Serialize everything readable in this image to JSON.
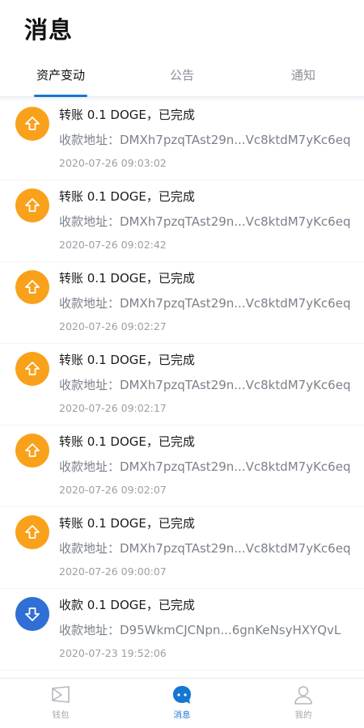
{
  "header": {
    "title": "消息"
  },
  "tabs": [
    {
      "label": "资产变动",
      "active": true
    },
    {
      "label": "公告",
      "active": false
    },
    {
      "label": "通知",
      "active": false
    }
  ],
  "colors": {
    "accent": "#1677d2",
    "outgoing": "#f9a11b",
    "incoming": "#2f6fd6"
  },
  "messages": [
    {
      "direction": "out",
      "icon": "arrow-up-icon",
      "title": "转账 0.1 DOGE，已完成",
      "address": "收款地址：DMXh7pzqTAst29n...Vc8ktdM7yKc6eq",
      "time": "2020-07-26 09:03:02"
    },
    {
      "direction": "out",
      "icon": "arrow-up-icon",
      "title": "转账 0.1 DOGE，已完成",
      "address": "收款地址：DMXh7pzqTAst29n...Vc8ktdM7yKc6eq",
      "time": "2020-07-26 09:02:42"
    },
    {
      "direction": "out",
      "icon": "arrow-up-icon",
      "title": "转账 0.1 DOGE，已完成",
      "address": "收款地址：DMXh7pzqTAst29n...Vc8ktdM7yKc6eq",
      "time": "2020-07-26 09:02:27"
    },
    {
      "direction": "out",
      "icon": "arrow-up-icon",
      "title": "转账 0.1 DOGE，已完成",
      "address": "收款地址：DMXh7pzqTAst29n...Vc8ktdM7yKc6eq",
      "time": "2020-07-26 09:02:17"
    },
    {
      "direction": "out",
      "icon": "arrow-up-icon",
      "title": "转账 0.1 DOGE，已完成",
      "address": "收款地址：DMXh7pzqTAst29n...Vc8ktdM7yKc6eq",
      "time": "2020-07-26 09:02:07"
    },
    {
      "direction": "out",
      "icon": "arrow-up-icon",
      "title": "转账 0.1 DOGE，已完成",
      "address": "收款地址：DMXh7pzqTAst29n...Vc8ktdM7yKc6eq",
      "time": "2020-07-26 09:00:07"
    },
    {
      "direction": "in",
      "icon": "arrow-down-icon",
      "title": "收款 0.1 DOGE，已完成",
      "address": "收款地址：D95WkmCJCNpn...6gnKeNsyHXYQvL",
      "time": "2020-07-23 19:52:06"
    }
  ],
  "bottom_nav": [
    {
      "label": "钱包",
      "icon": "wallet-icon",
      "active": false
    },
    {
      "label": "消息",
      "icon": "message-icon",
      "active": true
    },
    {
      "label": "我的",
      "icon": "profile-icon",
      "active": false
    }
  ]
}
